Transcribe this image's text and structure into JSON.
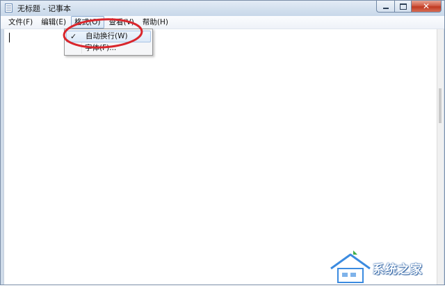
{
  "window": {
    "title": "无标题 - 记事本",
    "icon": "notepad-icon",
    "caption_buttons": {
      "minimize_icon": "minimize-icon",
      "maximize_icon": "maximize-icon",
      "close_label": "✕"
    }
  },
  "menubar": {
    "items": [
      {
        "label": "文件(F)"
      },
      {
        "label": "编辑(E)"
      },
      {
        "label": "格式(O)",
        "open": true
      },
      {
        "label": "查看(V)"
      },
      {
        "label": "帮助(H)"
      }
    ]
  },
  "format_menu": {
    "items": [
      {
        "label": "自动换行(W)",
        "checked": true,
        "check_glyph": "✓"
      },
      {
        "label": "字体(F)..."
      }
    ]
  },
  "editor": {
    "text": ""
  },
  "annotation": {
    "color": "#d9262c",
    "shape": "ellipse"
  },
  "watermark": {
    "text": "系统之家",
    "accent": "#3b8be0"
  }
}
